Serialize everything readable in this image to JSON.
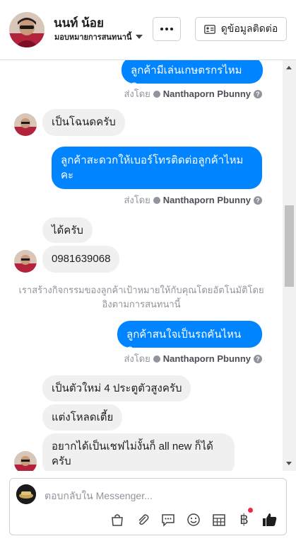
{
  "header": {
    "name": "นนท์ น้อย",
    "assign_label": "มอบหมายการสนทนานี้",
    "more_label": "More options",
    "info_button": "ดูข้อมูลติดต่อ"
  },
  "messages": {
    "out1": "ลูกค้ามีเล่นเกษตรกรไหมคะ",
    "sent_prefix": "ส่งโดย",
    "sender": "Nanthaporn Pbunny",
    "in1": "เป็นโฉนดครับ",
    "out2": "ลูกค้าสะดวกให้เบอร์โทรติดต่อลูกค้าไหมคะ",
    "in2": "ได้ครับ",
    "in3": "0981639068",
    "system": "เราสร้างกิจกรรมของลูกค้าเป้าหมายให้กับคุณโดยอัตโนมัติโดยอิงตามการสนทนานี้",
    "out3": "ลูกค้าสนใจเป็นรถคันไหนคะ",
    "in4": "เป็นตัวใหม่ 4 ประตูตัวสูงครับ",
    "in5": "แต่งโหลดเตี้ย",
    "in6": "อยากได้เป็นเชฟไม่งั้นก็ all new ก็ได้ครับ"
  },
  "composer": {
    "placeholder": "ตอบกลับใน Messenger..."
  },
  "colors": {
    "accent": "#0084ff",
    "incoming_bubble": "#f0f0f0",
    "notification": "#f02849"
  },
  "icons": [
    "more-icon",
    "contact-card-icon",
    "shop-bag-icon",
    "attachment-icon",
    "saved-reply-icon",
    "emoji-icon",
    "appointment-icon",
    "baht-icon",
    "like-icon"
  ]
}
